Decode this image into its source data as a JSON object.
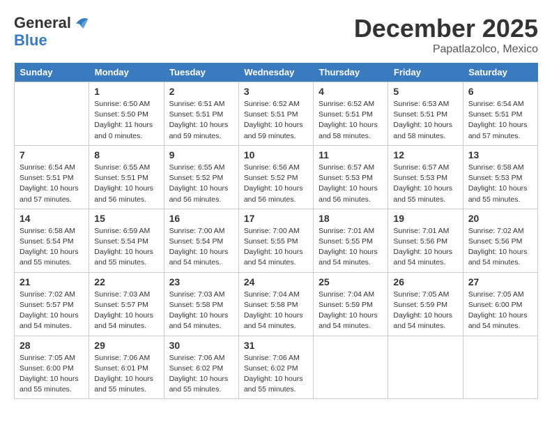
{
  "logo": {
    "line1": "General",
    "line2": "Blue"
  },
  "title": "December 2025",
  "location": "Papatlazolco, Mexico",
  "weekdays": [
    "Sunday",
    "Monday",
    "Tuesday",
    "Wednesday",
    "Thursday",
    "Friday",
    "Saturday"
  ],
  "weeks": [
    [
      {
        "day": "",
        "sunrise": "",
        "sunset": "",
        "daylight": ""
      },
      {
        "day": "1",
        "sunrise": "Sunrise: 6:50 AM",
        "sunset": "Sunset: 5:50 PM",
        "daylight": "Daylight: 11 hours and 0 minutes."
      },
      {
        "day": "2",
        "sunrise": "Sunrise: 6:51 AM",
        "sunset": "Sunset: 5:51 PM",
        "daylight": "Daylight: 10 hours and 59 minutes."
      },
      {
        "day": "3",
        "sunrise": "Sunrise: 6:52 AM",
        "sunset": "Sunset: 5:51 PM",
        "daylight": "Daylight: 10 hours and 59 minutes."
      },
      {
        "day": "4",
        "sunrise": "Sunrise: 6:52 AM",
        "sunset": "Sunset: 5:51 PM",
        "daylight": "Daylight: 10 hours and 58 minutes."
      },
      {
        "day": "5",
        "sunrise": "Sunrise: 6:53 AM",
        "sunset": "Sunset: 5:51 PM",
        "daylight": "Daylight: 10 hours and 58 minutes."
      },
      {
        "day": "6",
        "sunrise": "Sunrise: 6:54 AM",
        "sunset": "Sunset: 5:51 PM",
        "daylight": "Daylight: 10 hours and 57 minutes."
      }
    ],
    [
      {
        "day": "7",
        "sunrise": "Sunrise: 6:54 AM",
        "sunset": "Sunset: 5:51 PM",
        "daylight": "Daylight: 10 hours and 57 minutes."
      },
      {
        "day": "8",
        "sunrise": "Sunrise: 6:55 AM",
        "sunset": "Sunset: 5:51 PM",
        "daylight": "Daylight: 10 hours and 56 minutes."
      },
      {
        "day": "9",
        "sunrise": "Sunrise: 6:55 AM",
        "sunset": "Sunset: 5:52 PM",
        "daylight": "Daylight: 10 hours and 56 minutes."
      },
      {
        "day": "10",
        "sunrise": "Sunrise: 6:56 AM",
        "sunset": "Sunset: 5:52 PM",
        "daylight": "Daylight: 10 hours and 56 minutes."
      },
      {
        "day": "11",
        "sunrise": "Sunrise: 6:57 AM",
        "sunset": "Sunset: 5:53 PM",
        "daylight": "Daylight: 10 hours and 56 minutes."
      },
      {
        "day": "12",
        "sunrise": "Sunrise: 6:57 AM",
        "sunset": "Sunset: 5:53 PM",
        "daylight": "Daylight: 10 hours and 55 minutes."
      },
      {
        "day": "13",
        "sunrise": "Sunrise: 6:58 AM",
        "sunset": "Sunset: 5:53 PM",
        "daylight": "Daylight: 10 hours and 55 minutes."
      }
    ],
    [
      {
        "day": "14",
        "sunrise": "Sunrise: 6:58 AM",
        "sunset": "Sunset: 5:54 PM",
        "daylight": "Daylight: 10 hours and 55 minutes."
      },
      {
        "day": "15",
        "sunrise": "Sunrise: 6:59 AM",
        "sunset": "Sunset: 5:54 PM",
        "daylight": "Daylight: 10 hours and 55 minutes."
      },
      {
        "day": "16",
        "sunrise": "Sunrise: 7:00 AM",
        "sunset": "Sunset: 5:54 PM",
        "daylight": "Daylight: 10 hours and 54 minutes."
      },
      {
        "day": "17",
        "sunrise": "Sunrise: 7:00 AM",
        "sunset": "Sunset: 5:55 PM",
        "daylight": "Daylight: 10 hours and 54 minutes."
      },
      {
        "day": "18",
        "sunrise": "Sunrise: 7:01 AM",
        "sunset": "Sunset: 5:55 PM",
        "daylight": "Daylight: 10 hours and 54 minutes."
      },
      {
        "day": "19",
        "sunrise": "Sunrise: 7:01 AM",
        "sunset": "Sunset: 5:56 PM",
        "daylight": "Daylight: 10 hours and 54 minutes."
      },
      {
        "day": "20",
        "sunrise": "Sunrise: 7:02 AM",
        "sunset": "Sunset: 5:56 PM",
        "daylight": "Daylight: 10 hours and 54 minutes."
      }
    ],
    [
      {
        "day": "21",
        "sunrise": "Sunrise: 7:02 AM",
        "sunset": "Sunset: 5:57 PM",
        "daylight": "Daylight: 10 hours and 54 minutes."
      },
      {
        "day": "22",
        "sunrise": "Sunrise: 7:03 AM",
        "sunset": "Sunset: 5:57 PM",
        "daylight": "Daylight: 10 hours and 54 minutes."
      },
      {
        "day": "23",
        "sunrise": "Sunrise: 7:03 AM",
        "sunset": "Sunset: 5:58 PM",
        "daylight": "Daylight: 10 hours and 54 minutes."
      },
      {
        "day": "24",
        "sunrise": "Sunrise: 7:04 AM",
        "sunset": "Sunset: 5:58 PM",
        "daylight": "Daylight: 10 hours and 54 minutes."
      },
      {
        "day": "25",
        "sunrise": "Sunrise: 7:04 AM",
        "sunset": "Sunset: 5:59 PM",
        "daylight": "Daylight: 10 hours and 54 minutes."
      },
      {
        "day": "26",
        "sunrise": "Sunrise: 7:05 AM",
        "sunset": "Sunset: 5:59 PM",
        "daylight": "Daylight: 10 hours and 54 minutes."
      },
      {
        "day": "27",
        "sunrise": "Sunrise: 7:05 AM",
        "sunset": "Sunset: 6:00 PM",
        "daylight": "Daylight: 10 hours and 54 minutes."
      }
    ],
    [
      {
        "day": "28",
        "sunrise": "Sunrise: 7:05 AM",
        "sunset": "Sunset: 6:00 PM",
        "daylight": "Daylight: 10 hours and 55 minutes."
      },
      {
        "day": "29",
        "sunrise": "Sunrise: 7:06 AM",
        "sunset": "Sunset: 6:01 PM",
        "daylight": "Daylight: 10 hours and 55 minutes."
      },
      {
        "day": "30",
        "sunrise": "Sunrise: 7:06 AM",
        "sunset": "Sunset: 6:02 PM",
        "daylight": "Daylight: 10 hours and 55 minutes."
      },
      {
        "day": "31",
        "sunrise": "Sunrise: 7:06 AM",
        "sunset": "Sunset: 6:02 PM",
        "daylight": "Daylight: 10 hours and 55 minutes."
      },
      {
        "day": "",
        "sunrise": "",
        "sunset": "",
        "daylight": ""
      },
      {
        "day": "",
        "sunrise": "",
        "sunset": "",
        "daylight": ""
      },
      {
        "day": "",
        "sunrise": "",
        "sunset": "",
        "daylight": ""
      }
    ]
  ]
}
